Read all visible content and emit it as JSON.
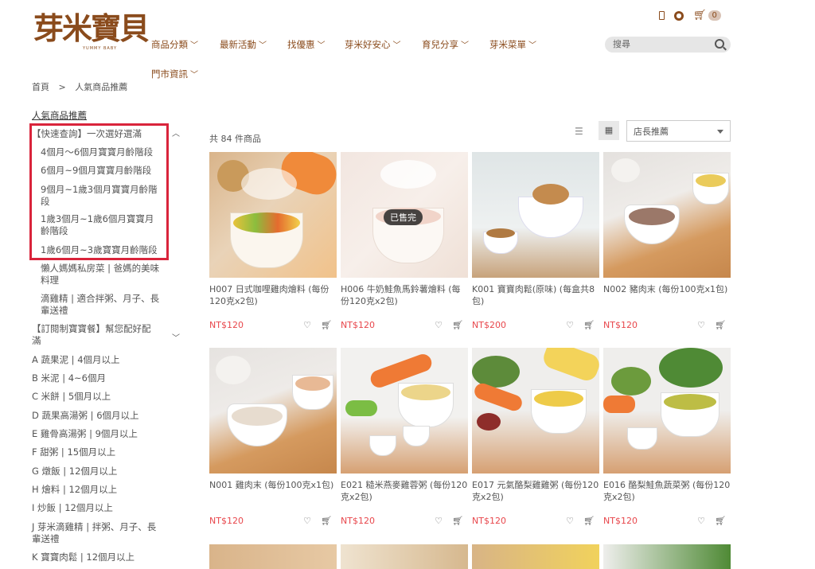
{
  "logo": {
    "text": "芽米寶貝",
    "sub": "YUMMY BABY"
  },
  "nav": [
    "商品分類",
    "最新活動",
    "找優惠",
    "芽米好安心",
    "育兒分享",
    "芽米菜單",
    "門市資訊"
  ],
  "cart_count": "0",
  "search": {
    "placeholder": "搜尋"
  },
  "breadcrumb": {
    "home": "首頁",
    "sep": ">",
    "current": "人氣商品推薦"
  },
  "sidebar": {
    "title": "人氣商品推薦",
    "quick_query": "【快速查詢】一次選好選滿",
    "quick_items": [
      "4個月～6個月寶寶月齡階段",
      "6個月~9個月寶寶月齡階段",
      "9個月~1歲3個月寶寶月齡階段",
      "1歲3個月~1歲6個月寶寶月齡階段",
      "1歲6個月~3歲寶寶月齡階段"
    ],
    "extra_items": [
      "懶人媽媽私房菜 | 爸媽的美味料理",
      "滴雞精 | 適合拌粥、月子、長輩送禮"
    ],
    "custom_title": "【訂閱制寶寶餐】幫您配好配滿",
    "categories": [
      "A 蔬果泥 | 4個月以上",
      "B 米泥 | 4~6個月",
      "C 米餅 | 5個月以上",
      "D 蔬果高湯粥 | 6個月以上",
      "E 雞骨高湯粥 | 9個月以上",
      "F 甜粥 | 15個月以上",
      "G 燉飯 | 12個月以上",
      "H 燴料 | 12個月以上",
      "I 炒飯 | 12個月以上",
      "J 芽米滴雞精 | 拌粥、月子、長輩送禮",
      "K 寶寶肉鬆 | 12個月以上"
    ]
  },
  "toolbar": {
    "count": "共 84 件商品",
    "sort": "店長推薦"
  },
  "products": [
    {
      "name": "H007 日式咖哩雞肉燴料 (每份120克x2包)",
      "price": "NT$120"
    },
    {
      "name": "H006 牛奶鮭魚馬鈴薯燴料 (每份120克x2包)",
      "price": "NT$120",
      "badge": "已售完"
    },
    {
      "name": "K001 寶寶肉鬆(原味) (每盒共8包)",
      "price": "NT$200"
    },
    {
      "name": "N002 豬肉末 (每份100克x1包)",
      "price": "NT$120"
    },
    {
      "name": "N001 雞肉末 (每份100克x1包)",
      "price": "NT$120"
    },
    {
      "name": "E021 糙米燕麥雞蓉粥 (每份120克x2包)",
      "price": "NT$120"
    },
    {
      "name": "E017 元氣酪梨雞雞粥 (每份120克x2包)",
      "price": "NT$120"
    },
    {
      "name": "E016 酪梨鮭魚蔬菜粥 (每份120克x2包)",
      "price": "NT$120"
    }
  ]
}
